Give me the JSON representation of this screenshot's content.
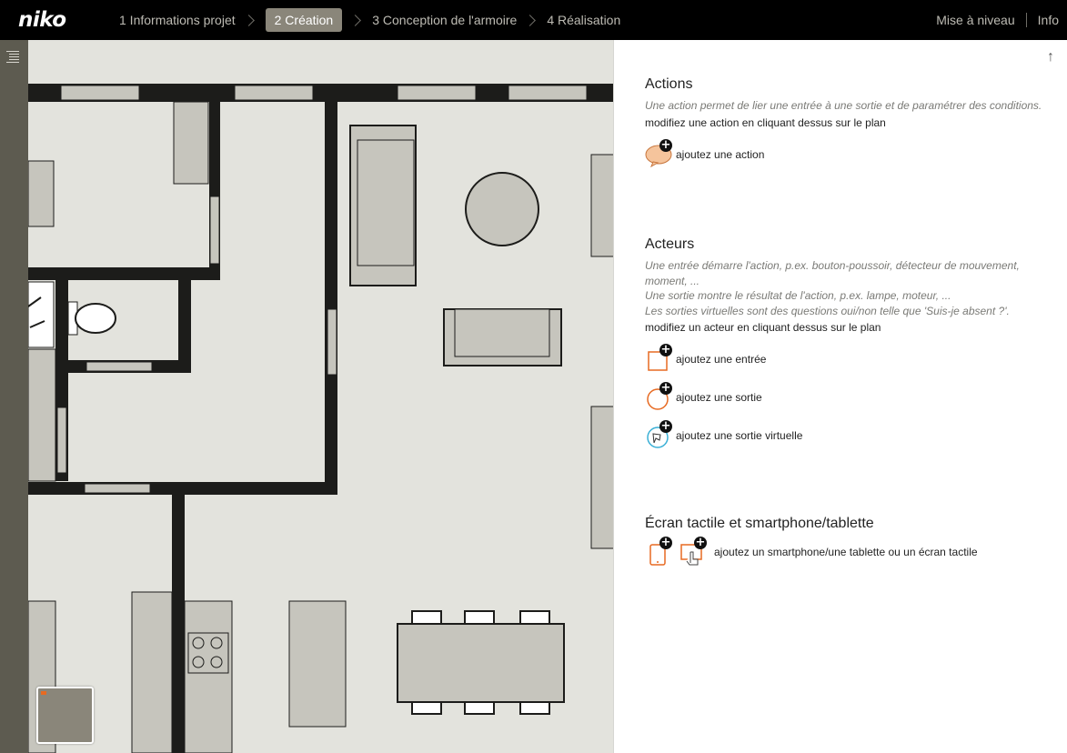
{
  "topbar": {
    "logo": "niko",
    "steps": [
      {
        "label": "1 Informations projet"
      },
      {
        "label": "2 Création"
      },
      {
        "label": "3 Conception de l'armoire"
      },
      {
        "label": "4 Réalisation"
      }
    ],
    "upgrade_label": "Mise à niveau",
    "info_label": "Info"
  },
  "colors": {
    "topbar_bg": "#000000",
    "active_step_bg": "#8a867a",
    "rail_bg": "#5d5b50",
    "plan_bg": "#e3e3dd",
    "wall": "#1c1c1a",
    "furniture": "#c6c5bd",
    "accent": "#e76a22"
  },
  "panel": {
    "actions": {
      "title": "Actions",
      "description": "Une action permet de lier une entrée à une sortie et de paramétrer des conditions.",
      "hint": "modifiez une action en cliquant dessus sur le plan",
      "add_action": "ajoutez une action"
    },
    "actors": {
      "title": "Acteurs",
      "desc_input": "Une entrée démarre l'action, p.ex. bouton-poussoir, détecteur de mouvement, moment, ...",
      "desc_output": "Une sortie montre le résultat de l'action, p.ex. lampe, moteur, ...",
      "desc_virtual": "Les sorties virtuelles sont des questions oui/non telle que 'Suis-je absent ?'.",
      "hint": "modifiez un acteur en cliquant dessus sur le plan",
      "add_input": "ajoutez une entrée",
      "add_output": "ajoutez une sortie",
      "add_virtual_output": "ajoutez une sortie virtuelle"
    },
    "touchscreen": {
      "title": "Écran tactile et smartphone/tablette",
      "add_device": "ajoutez un smartphone/une tablette ou un écran tactile"
    },
    "icons": {
      "scroll_up": "arrow-up-icon",
      "menu": "list-menu-icon",
      "action": "speech-bubble-icon",
      "input": "square-input-icon",
      "output": "circle-output-icon",
      "virtual_output": "virtual-output-icon",
      "smartphone": "smartphone-icon",
      "touchscreen": "touchscreen-icon",
      "plus": "plus-icon"
    }
  }
}
